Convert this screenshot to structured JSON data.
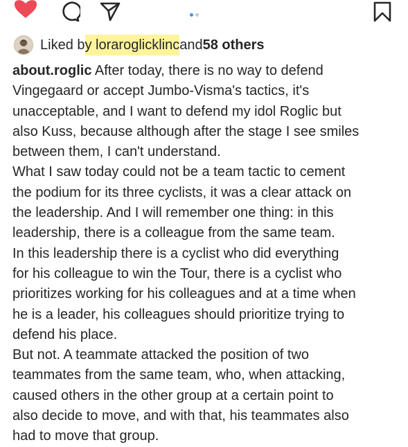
{
  "action_bar": {
    "icons": [
      "heart-icon",
      "comment-icon",
      "share-icon",
      "bookmark-icon"
    ],
    "heart_color": "#ed4956",
    "carousel_dots": {
      "count": 2,
      "active_index": 0,
      "active_color": "#3897f0",
      "inactive_color": "#c7c7c7"
    }
  },
  "likes": {
    "prefix": "Liked b",
    "user_highlighted": "y loraroglicklinc",
    "joiner": " and ",
    "others": "58 others",
    "highlight_color": "#fff49a"
  },
  "caption": {
    "username": "about.roglic",
    "first_line_rest": " After today, there is no way to defend",
    "lines": [
      "Vingegaard or accept Jumbo-Visma's tactics, it's",
      "unacceptable, and I want to defend my idol Roglic but",
      "also Kuss, because although after the stage I see smiles",
      "between them, I can't understand.",
      "What I saw today could not be a team tactic to cement",
      "the podium for its three cyclists, it was a clear attack on",
      "the leadership. And I will remember one thing: in this",
      "leadership, there is a colleague from the same team.",
      "In this leadership there is a cyclist who did everything",
      "for his colleague to win the Tour, there is a cyclist who",
      "prioritizes working for his colleagues and at a time when",
      "he is a leader, his colleagues should prioritize trying to",
      "defend his place.",
      "But not. A teammate attacked the position of two",
      "teammates from the same team, who, when attacking,",
      "caused others in the other group at a certain point to",
      "also decide to move, and with that, his teammates also",
      "had to move that group."
    ]
  }
}
